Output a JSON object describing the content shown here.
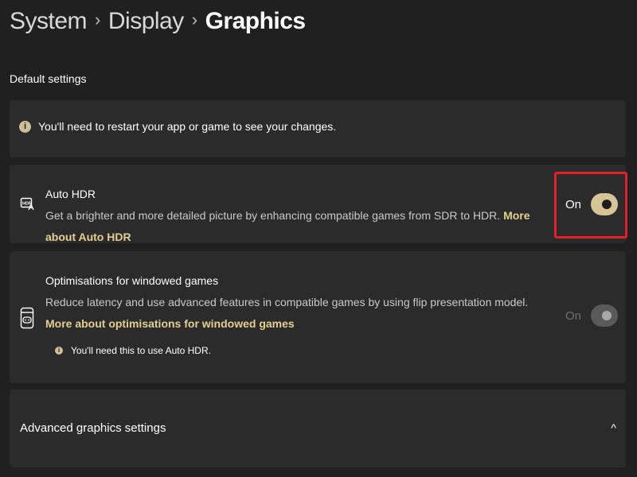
{
  "breadcrumb": {
    "items": [
      "System",
      "Display",
      "Graphics"
    ],
    "separator": "›"
  },
  "section": {
    "title": "Default settings"
  },
  "info_banner": {
    "icon": "info-icon",
    "glyph": "i",
    "text": "You'll need to restart your app or game to see your changes."
  },
  "auto_hdr": {
    "icon": "hdr-icon",
    "title": "Auto HDR",
    "description": "Get a brighter and more detailed picture by enhancing compatible games from SDR to HDR.",
    "link": "More about Auto HDR",
    "toggle_label": "On",
    "toggle_on": true,
    "toggle_enabled": true
  },
  "windowed_games": {
    "icon": "game-window-icon",
    "title": "Optimisations for windowed games",
    "description": "Reduce latency and use advanced features in compatible games by using flip presentation model.",
    "link": "More about optimisations for windowed games",
    "toggle_label": "On",
    "toggle_on": true,
    "toggle_enabled": false,
    "note_glyph": "i",
    "note": "You'll need this to use Auto HDR."
  },
  "advanced": {
    "label": "Advanced graphics settings",
    "chevron": "^",
    "icon": "chevron-up-icon"
  },
  "colors": {
    "background": "#202020",
    "card": "#2b2b2b",
    "accent": "#d7c497",
    "link": "#e3cf8e",
    "highlight": "#e5202a"
  }
}
